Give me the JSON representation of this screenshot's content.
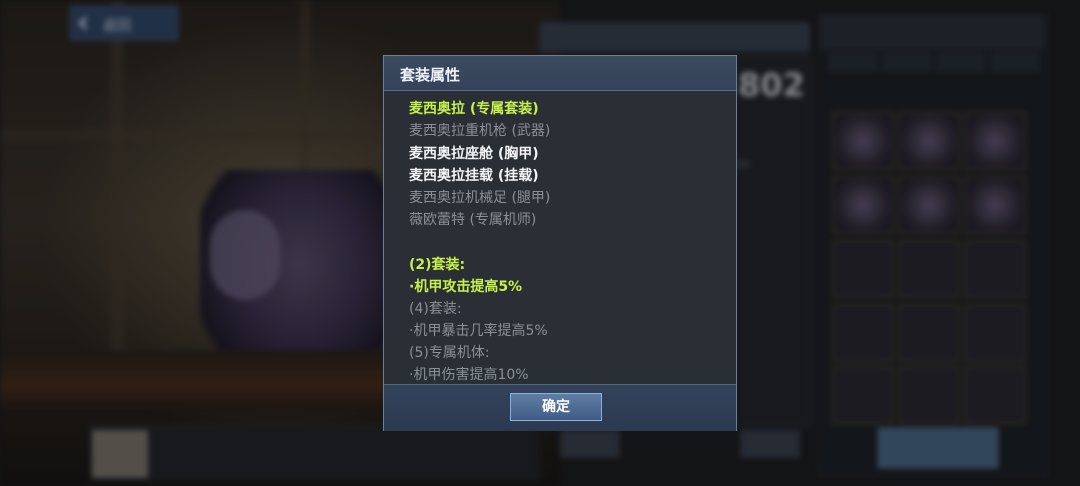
{
  "background": {
    "back_label": "返回",
    "power_value": "802"
  },
  "dialog": {
    "title": "套装属性",
    "lines": [
      {
        "text": "麦西奥拉 (专属套装)",
        "style": "green"
      },
      {
        "text": "麦西奥拉重机枪 (武器)",
        "style": "gray"
      },
      {
        "text": "麦西奥拉座舱 (胸甲)",
        "style": "white"
      },
      {
        "text": "麦西奥拉挂载 (挂载)",
        "style": "white"
      },
      {
        "text": "麦西奥拉机械足 (腿甲)",
        "style": "gray"
      },
      {
        "text": "薇欧蕾特 (专属机师)",
        "style": "gray"
      },
      {
        "text": "(2)套装:",
        "style": "green"
      },
      {
        "text": "·机甲攻击提高5%",
        "style": "green"
      },
      {
        "text": "(4)套装:",
        "style": "gray"
      },
      {
        "text": "·机甲暴击几率提高5%",
        "style": "gray"
      },
      {
        "text": "(5)专属机体:",
        "style": "gray"
      },
      {
        "text": "·机甲伤害提高10%",
        "style": "gray"
      }
    ],
    "confirm_label": "确定"
  },
  "colors": {
    "green": "#c8f04a",
    "gray": "#8b8f96",
    "white": "#f2f4f7",
    "button": "#4f6d95"
  }
}
